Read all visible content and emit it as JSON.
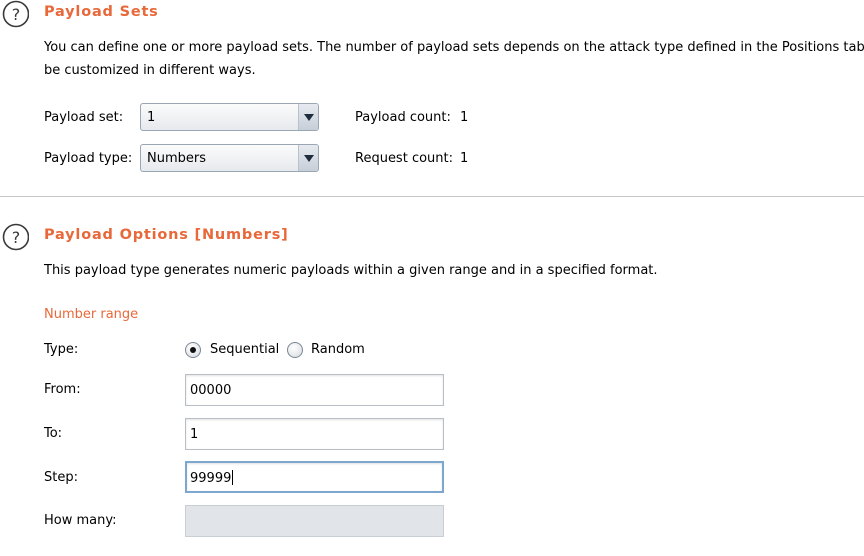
{
  "payload_sets": {
    "title": "Payload Sets",
    "description_line1": "You can define one or more payload sets. The number of payload sets depends on the attack type defined in the Positions tab. V",
    "description_line2": "be customized in different ways.",
    "payload_set_label": "Payload set:",
    "payload_set_value": "1",
    "payload_type_label": "Payload type:",
    "payload_type_value": "Numbers",
    "payload_count_label": "Payload count:",
    "payload_count_value": "1",
    "request_count_label": "Request count:",
    "request_count_value": "1"
  },
  "payload_options": {
    "title": "Payload Options [Numbers]",
    "description": "This payload type generates numeric payloads within a given range and in a specified format.",
    "number_range_heading": "Number range",
    "type_label": "Type:",
    "type_options": [
      "Sequential",
      "Random"
    ],
    "type_selected": "Sequential",
    "from_label": "From:",
    "from_value": "00000",
    "to_label": "To:",
    "to_value": "1",
    "step_label": "Step:",
    "step_value": "99999",
    "how_many_label": "How many:",
    "how_many_value": ""
  },
  "colors": {
    "accent": "#e8683a",
    "focus": "#7ea7cf"
  },
  "icons": [
    "help-icon",
    "chevron-down-icon",
    "radio-selected",
    "radio-unselected"
  ]
}
